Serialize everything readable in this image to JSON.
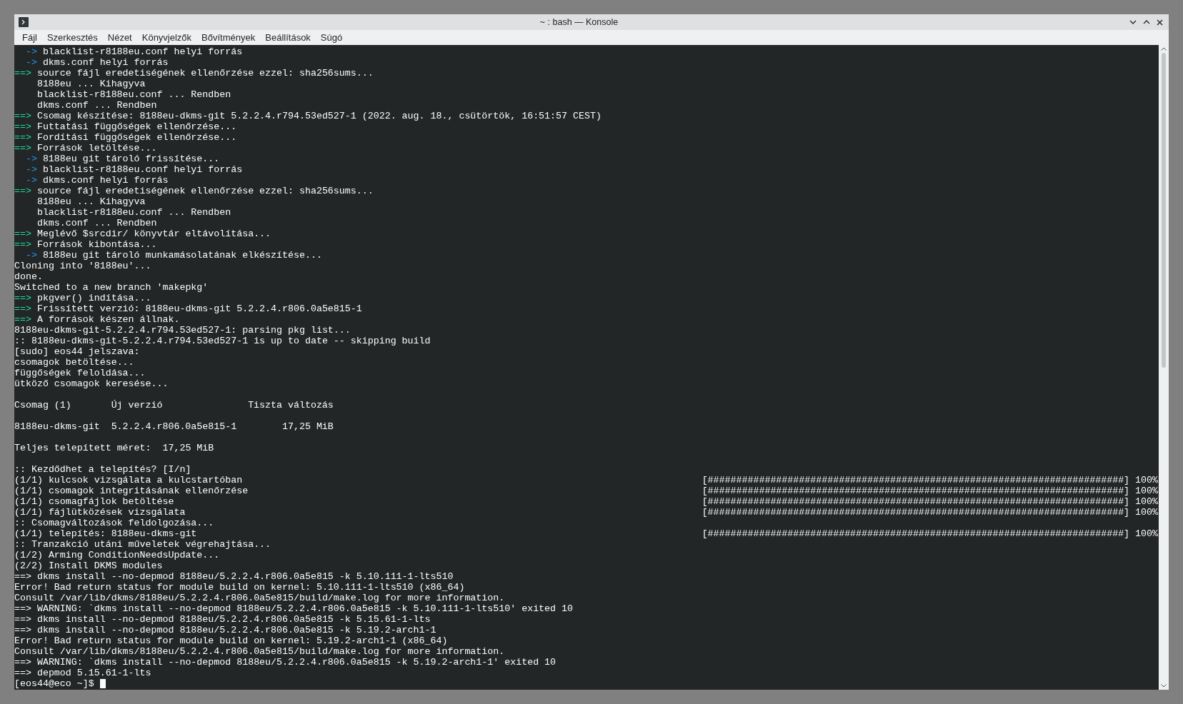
{
  "window": {
    "title": "~ : bash — Konsole"
  },
  "menu": [
    "Fájl",
    "Szerkesztés",
    "Nézet",
    "Könyvjelzők",
    "Bővítmények",
    "Beállítások",
    "Súgó"
  ],
  "terminal": {
    "lines": [
      {
        "kind": "sub",
        "marker": "->",
        "text": "blacklist-r8188eu.conf helyi forrás"
      },
      {
        "kind": "sub",
        "marker": "->",
        "text": "dkms.conf helyi forrás"
      },
      {
        "kind": "arrow",
        "marker": "==>",
        "text": "source fájl eredetiségének ellenőrzése ezzel: sha256sums..."
      },
      {
        "kind": "indented",
        "text": "8188eu ... Kihagyva"
      },
      {
        "kind": "indented",
        "text": "blacklist-r8188eu.conf ... Rendben"
      },
      {
        "kind": "indented",
        "text": "dkms.conf ... Rendben"
      },
      {
        "kind": "arrow",
        "marker": "==>",
        "text": "Csomag készítése: 8188eu-dkms-git 5.2.2.4.r794.53ed527-1 (2022. aug. 18., csütörtök, 16:51:57 CEST)"
      },
      {
        "kind": "arrow",
        "marker": "==>",
        "text": "Futtatási függőségek ellenőrzése..."
      },
      {
        "kind": "arrow",
        "marker": "==>",
        "text": "Fordítási függőségek ellenőrzése..."
      },
      {
        "kind": "arrow",
        "marker": "==>",
        "text": "Források letöltése..."
      },
      {
        "kind": "sub",
        "marker": "->",
        "text": "8188eu git tároló frissítése..."
      },
      {
        "kind": "sub",
        "marker": "->",
        "text": "blacklist-r8188eu.conf helyi forrás"
      },
      {
        "kind": "sub",
        "marker": "->",
        "text": "dkms.conf helyi forrás"
      },
      {
        "kind": "arrow",
        "marker": "==>",
        "text": "source fájl eredetiségének ellenőrzése ezzel: sha256sums..."
      },
      {
        "kind": "indented",
        "text": "8188eu ... Kihagyva"
      },
      {
        "kind": "indented",
        "text": "blacklist-r8188eu.conf ... Rendben"
      },
      {
        "kind": "indented",
        "text": "dkms.conf ... Rendben"
      },
      {
        "kind": "arrow",
        "marker": "==>",
        "text": "Meglévő $srcdir/ könyvtár eltávolítása..."
      },
      {
        "kind": "arrow",
        "marker": "==>",
        "text": "Források kibontása..."
      },
      {
        "kind": "sub",
        "marker": "->",
        "text": "8188eu git tároló munkamásolatának elkészítése..."
      },
      {
        "kind": "plain",
        "text": "Cloning into '8188eu'..."
      },
      {
        "kind": "plain",
        "text": "done."
      },
      {
        "kind": "plain",
        "text": "Switched to a new branch 'makepkg'"
      },
      {
        "kind": "arrow",
        "marker": "==>",
        "text": "pkgver() indítása..."
      },
      {
        "kind": "arrow",
        "marker": "==>",
        "text": "Frissített verzió: 8188eu-dkms-git 5.2.2.4.r806.0a5e815-1"
      },
      {
        "kind": "arrow",
        "marker": "==>",
        "text": "A források készen állnak."
      },
      {
        "kind": "plain",
        "text": "8188eu-dkms-git-5.2.2.4.r794.53ed527-1: parsing pkg list..."
      },
      {
        "kind": "plain",
        "text": ":: 8188eu-dkms-git-5.2.2.4.r794.53ed527-1 is up to date -- skipping build"
      },
      {
        "kind": "plain",
        "text": "[sudo] eos44 jelszava:"
      },
      {
        "kind": "plain",
        "text": "csomagok betöltése..."
      },
      {
        "kind": "plain",
        "text": "függőségek feloldása..."
      },
      {
        "kind": "plain",
        "text": "ütköző csomagok keresése..."
      },
      {
        "kind": "blank"
      },
      {
        "kind": "columns",
        "cells": [
          "Csomag (1)",
          "Új verzió",
          "Tiszta változás"
        ]
      },
      {
        "kind": "blank"
      },
      {
        "kind": "columns",
        "cells": [
          "8188eu-dkms-git",
          "5.2.2.4.r806.0a5e815-1",
          "17,25 MiB"
        ]
      },
      {
        "kind": "blank"
      },
      {
        "kind": "plain",
        "text": "Teljes telepített méret:  17,25 MiB"
      },
      {
        "kind": "blank"
      },
      {
        "kind": "plain",
        "text": ":: Kezdődhet a telepítés? [I/n]"
      },
      {
        "kind": "progress",
        "text": "(1/1) kulcsok vizsgálata a kulcstartóban",
        "bar": "[#########################################################################]",
        "percent": "100%"
      },
      {
        "kind": "progress",
        "text": "(1/1) csomagok integritásának ellenőrzése",
        "bar": "[#########################################################################]",
        "percent": "100%"
      },
      {
        "kind": "progress",
        "text": "(1/1) csomagfájlok betöltése",
        "bar": "[#########################################################################]",
        "percent": "100%"
      },
      {
        "kind": "progress",
        "text": "(1/1) fájlütközések vizsgálata",
        "bar": "[#########################################################################]",
        "percent": "100%"
      },
      {
        "kind": "plain",
        "text": ":: Csomagváltozások feldolgozása..."
      },
      {
        "kind": "progress",
        "text": "(1/1) telepítés: 8188eu-dkms-git",
        "bar": "[#########################################################################]",
        "percent": "100%"
      },
      {
        "kind": "plain",
        "text": ":: Tranzakció utáni műveletek végrehajtása..."
      },
      {
        "kind": "plain",
        "text": "(1/2) Arming ConditionNeedsUpdate..."
      },
      {
        "kind": "plain",
        "text": "(2/2) Install DKMS modules"
      },
      {
        "kind": "plain",
        "text": "==> dkms install --no-depmod 8188eu/5.2.2.4.r806.0a5e815 -k 5.10.111-1-lts510"
      },
      {
        "kind": "plain",
        "text": "Error! Bad return status for module build on kernel: 5.10.111-1-lts510 (x86_64)"
      },
      {
        "kind": "plain",
        "text": "Consult /var/lib/dkms/8188eu/5.2.2.4.r806.0a5e815/build/make.log for more information."
      },
      {
        "kind": "plain",
        "text": "==> WARNING: `dkms install --no-depmod 8188eu/5.2.2.4.r806.0a5e815 -k 5.10.111-1-lts510' exited 10"
      },
      {
        "kind": "plain",
        "text": "==> dkms install --no-depmod 8188eu/5.2.2.4.r806.0a5e815 -k 5.15.61-1-lts"
      },
      {
        "kind": "plain",
        "text": "==> dkms install --no-depmod 8188eu/5.2.2.4.r806.0a5e815 -k 5.19.2-arch1-1"
      },
      {
        "kind": "plain",
        "text": "Error! Bad return status for module build on kernel: 5.19.2-arch1-1 (x86_64)"
      },
      {
        "kind": "plain",
        "text": "Consult /var/lib/dkms/8188eu/5.2.2.4.r806.0a5e815/build/make.log for more information."
      },
      {
        "kind": "plain",
        "text": "==> WARNING: `dkms install --no-depmod 8188eu/5.2.2.4.r806.0a5e815 -k 5.19.2-arch1-1' exited 10"
      },
      {
        "kind": "plain",
        "text": "==> depmod 5.15.61-1-lts"
      },
      {
        "kind": "prompt",
        "text": "[eos44@eco ~]$"
      }
    ]
  }
}
